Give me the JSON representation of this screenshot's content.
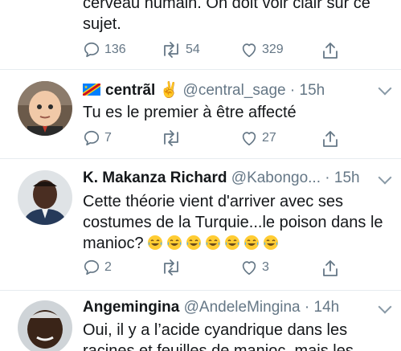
{
  "tweets": [
    {
      "text": "cerveau humain. On doit voir clair sur ce sujet.",
      "reply_count": "136",
      "retweet_count": "54",
      "like_count": "329"
    },
    {
      "name": "centrãl ✌️",
      "handle": "@central_sage",
      "time": "· 15h",
      "text": "Tu es le premier à être affecté",
      "reply_count": "7",
      "retweet_count": "",
      "like_count": "27"
    },
    {
      "name": "K. Makanza Richard",
      "handle": "@Kabongo...",
      "time": "· 15h",
      "text": "Cette théorie vient d'arriver avec ses costumes de la Turquie...le poison dans le manioc?",
      "emoji_count": 7,
      "reply_count": "2",
      "retweet_count": "",
      "like_count": "3"
    },
    {
      "name": "Angemingina",
      "handle": "@AndeleMingina",
      "time": "· 14h",
      "text": "Oui, il y a l’acide cyandrique dans les racines et feuilles de manioc, mais les"
    }
  ],
  "colors": {
    "text": "#14171a",
    "muted": "#657786",
    "divider": "#e6ecf0"
  }
}
